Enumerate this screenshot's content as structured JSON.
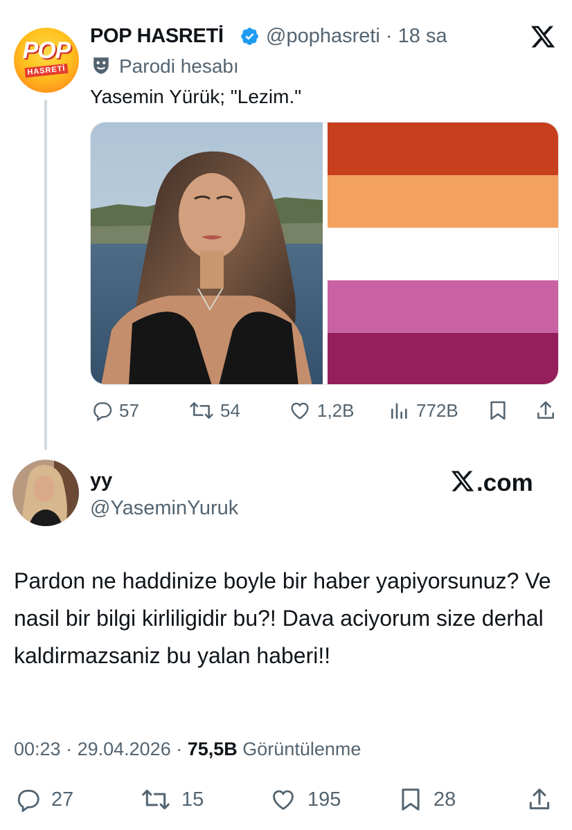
{
  "tweet": {
    "author_name": "POP HASRETİ",
    "author_handle": "@pophasreti",
    "time_ago": "18 sa",
    "parody_label": "Parodi hesabı",
    "avatar_text_top": "POP",
    "avatar_text_bottom": "HASRETİ",
    "text": "Yasemin Yürük; \"Lezim.\"",
    "media": {
      "flag_colors": [
        "#c83f1e",
        "#f2a15f",
        "#ffffff",
        "#c862a2",
        "#941f5c"
      ]
    },
    "actions": {
      "replies": "57",
      "retweets": "54",
      "likes": "1,2B",
      "views": "772B"
    }
  },
  "quoted": {
    "name": "yy",
    "handle": "@YaseminYuruk",
    "brand": "X.com",
    "text": "Pardon ne haddinize boyle bir haber yapiyorsunuz? Ve nasil bir bilgi kirliligidir bu?! Dava aciyorum size derhal kaldirmazsaniz bu yalan haberi!!",
    "time": "00:23",
    "date": "29.04.2026",
    "views_count": "75,5B",
    "views_label": "Görüntülenme",
    "actions": {
      "replies": "27",
      "retweets": "15",
      "likes": "195",
      "bookmarks": "28"
    }
  },
  "colors": {
    "text_primary": "#0f1419",
    "text_secondary": "#536471",
    "verified_blue": "#1d9bf0",
    "thread_line": "#cfd9de"
  },
  "icons": [
    "pop-hasreti-logo",
    "verified-badge-icon",
    "x-logo-icon",
    "parody-mask-icon",
    "reply-icon",
    "retweet-icon",
    "like-icon",
    "views-icon",
    "bookmark-icon",
    "share-icon"
  ]
}
